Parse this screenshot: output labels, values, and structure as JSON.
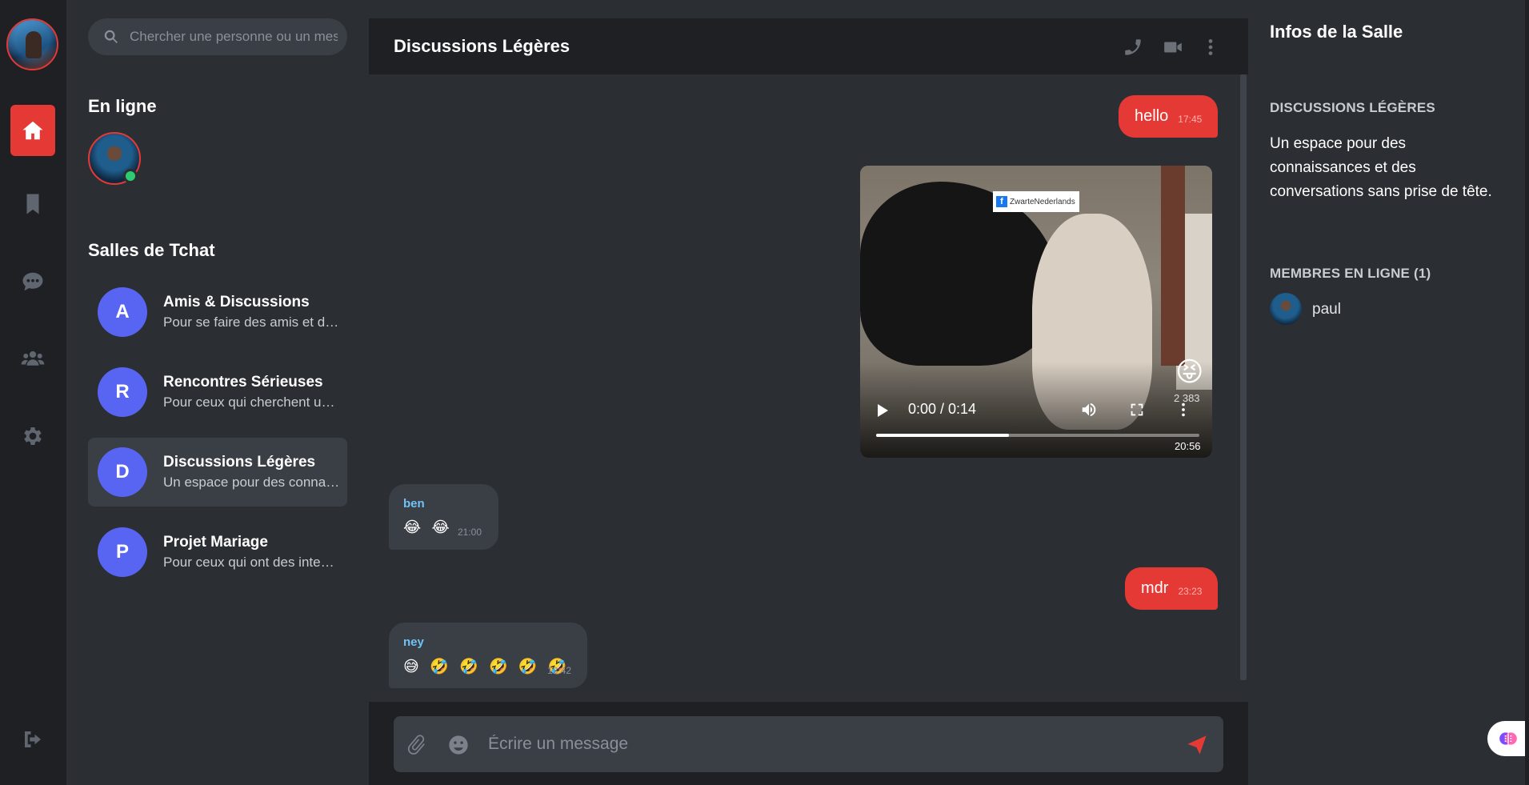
{
  "rail": {
    "items": [
      {
        "icon": "home-icon",
        "active": true
      },
      {
        "icon": "bookmark-icon",
        "active": false
      },
      {
        "icon": "chat-bubble-icon",
        "active": false
      },
      {
        "icon": "users-icon",
        "active": false
      },
      {
        "icon": "gear-icon",
        "active": false
      }
    ],
    "logout_icon": "logout-icon"
  },
  "sidebar": {
    "search_placeholder": "Chercher une personne ou un message",
    "online_title": "En ligne",
    "rooms_title": "Salles de Tchat",
    "rooms": [
      {
        "initial": "A",
        "name": "Amis & Discussions",
        "desc": "Pour se faire des amis et discuter",
        "active": false
      },
      {
        "initial": "R",
        "name": "Rencontres Sérieuses",
        "desc": "Pour ceux qui cherchent une relation",
        "active": false
      },
      {
        "initial": "D",
        "name": "Discussions Légères",
        "desc": "Un espace pour des connaissances",
        "active": true
      },
      {
        "initial": "P",
        "name": "Projet Mariage",
        "desc": "Pour ceux qui ont des intentions",
        "active": false
      }
    ]
  },
  "chat": {
    "title": "Discussions Légères",
    "messages": [
      {
        "type": "out",
        "text": "hello",
        "time": "17:45"
      },
      {
        "type": "video",
        "watermark": "ZwarteNederlands",
        "reaction": "😝",
        "reaction_count": "2 383",
        "player_time": "0:00 / 0:14",
        "progress": 0.41,
        "time": "20:56"
      },
      {
        "type": "in",
        "sender": "ben",
        "text": "😂 😂",
        "time": "21:00"
      },
      {
        "type": "out",
        "text": "mdr",
        "time": "23:23"
      },
      {
        "type": "in",
        "sender": "ney",
        "text": "😅 🤣 🤣 🤣 🤣 🤣",
        "time": "13:42"
      }
    ],
    "composer_placeholder": "Écrire un message"
  },
  "info": {
    "title": "Infos de la Salle",
    "room_name": "DISCUSSIONS LÉGÈRES",
    "description": "Un espace pour des connaissances et des conversations sans prise de tête.",
    "members_title": "MEMBRES EN LIGNE (1)",
    "members": [
      {
        "name": "paul"
      }
    ]
  },
  "colors": {
    "accent": "#e53935",
    "room_badge": "#5865f2",
    "online": "#2ecc71",
    "sender": "#6fc3f7"
  }
}
